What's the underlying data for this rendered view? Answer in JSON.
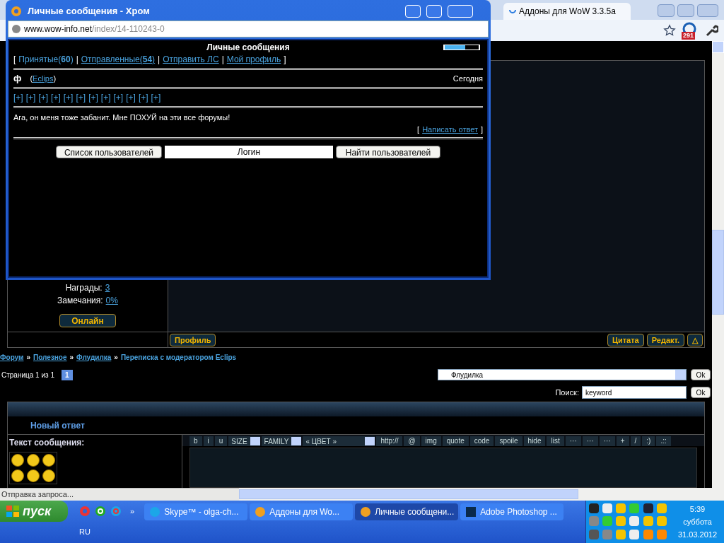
{
  "browser": {
    "tab_title": "Аддоны для WoW 3.3.5а",
    "badge": "291",
    "profile": {
      "awards_label": "Награды:",
      "awards": "3",
      "warnings_label": "Замечания:",
      "warnings": "0%",
      "status_button": "Онлайн"
    },
    "post_buttons": [
      {
        "label": "Профиль",
        "kind": "profile"
      },
      {
        "label": "Цитата",
        "kind": "action"
      },
      {
        "label": "Редакт.",
        "kind": "action"
      },
      {
        "label": "△",
        "kind": "action"
      }
    ],
    "breadcrumbs": [
      {
        "label": "Форум",
        "link": true
      },
      {
        "label": "Полезное",
        "link": true
      },
      {
        "label": "Флудилка",
        "link": true
      },
      {
        "label": "Переписка с модератором Eclips",
        "link": false
      }
    ],
    "breadcrumb_separator": "»",
    "pagination": {
      "label": "Страница 1 из 1",
      "pages": [
        {
          "label": "1",
          "selected": true
        }
      ]
    },
    "forum_select": {
      "value": "Флудилка",
      "button": "Ok"
    },
    "search": {
      "label": "Поиск:",
      "value": "keyword",
      "button": "Ok"
    },
    "reply": {
      "title": "Новый ответ",
      "text_label": "Текст сообщения:",
      "toolbar": [
        {
          "label": "b",
          "kind": "button"
        },
        {
          "label": "i",
          "kind": "button"
        },
        {
          "label": "u",
          "kind": "button"
        },
        {
          "label": "SIZE",
          "kind": "select"
        },
        {
          "label": "FAMILY",
          "kind": "select"
        },
        {
          "label": "« ЦВЕТ »",
          "kind": "wide-select"
        },
        {
          "label": "http://",
          "kind": "button"
        },
        {
          "label": "@",
          "kind": "button"
        },
        {
          "label": "img",
          "kind": "button"
        },
        {
          "label": "quote",
          "kind": "button"
        },
        {
          "label": "code",
          "kind": "button"
        },
        {
          "label": "spoile",
          "kind": "button"
        },
        {
          "label": "hide",
          "kind": "button"
        },
        {
          "label": "list",
          "kind": "button"
        },
        {
          "label": "···",
          "kind": "button"
        },
        {
          "label": "···",
          "kind": "button"
        },
        {
          "label": "···",
          "kind": "button"
        },
        {
          "label": "+",
          "kind": "button"
        },
        {
          "label": "/",
          "kind": "button"
        },
        {
          "label": ":)",
          "kind": "button"
        },
        {
          "label": ".::",
          "kind": "button"
        }
      ],
      "smiley_rows": [
        {
          "kind": "smileys"
        }
      ]
    },
    "status": "Отправка запроса..."
  },
  "popup": {
    "title": "Личные сообщения - Хром",
    "url_host": "www.wow-info.net",
    "url_path": "/index/14-110243-0",
    "heading": "Личные сообщения",
    "level": 0.6,
    "nav_brackets": [
      "[",
      "]"
    ],
    "nav_separator": "|",
    "nav": [
      {
        "label": "Принятые(**60**)",
        "selected": true
      },
      {
        "label": "Отправленные(**54**)",
        "selected": false
      },
      {
        "label": "Отправить ЛС",
        "selected": false
      },
      {
        "label": "Мой профиль",
        "selected": false
      }
    ],
    "message": {
      "sender_icon": "ф",
      "sender_open": "(",
      "sender": "Eclips",
      "sender_close": ")",
      "date": "Сегодня",
      "plus_links": [
        "[+]",
        "[+]",
        "[+]",
        "[+]",
        "[+]",
        "[+]",
        "[+]",
        "[+]",
        "[+]",
        "[+]",
        "[+]",
        "[+]"
      ],
      "text": "Ага, он меня тоже забанит. Мне ПОХУЙ на эти все форумы!",
      "reply_link": "Написать ответ"
    },
    "user_list_button": "Список пользователей",
    "login_value": "Логин",
    "find_button": "Найти пользователей"
  },
  "taskbar": {
    "start": "пуск",
    "more": "»",
    "tasks": [
      {
        "label": "Skype™ - olga-ch...",
        "kind": "skype",
        "selected": false
      },
      {
        "label": "Аддоны для Wo...",
        "kind": "browser",
        "selected": false
      },
      {
        "label": "Личные сообщени...",
        "kind": "browser",
        "selected": true
      },
      {
        "label": "Adobe Photoshop ...",
        "kind": "photoshop",
        "selected": false
      }
    ],
    "language": "RU",
    "time": "5:39",
    "day": "суббота",
    "date": "31.03.2012"
  }
}
